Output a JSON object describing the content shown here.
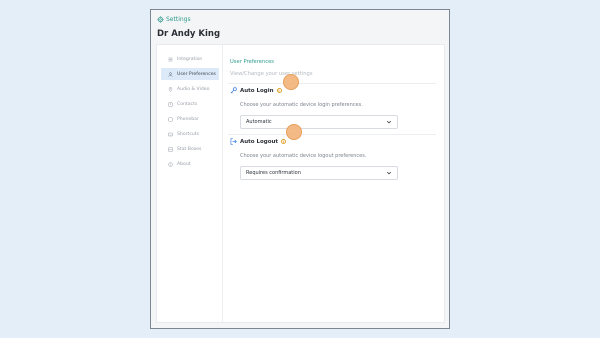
{
  "header": {
    "settings_label": "Settings",
    "user_name": "Dr Andy King"
  },
  "sidebar": {
    "items": [
      {
        "label": "Integration",
        "icon": "list-icon"
      },
      {
        "label": "User Preferences",
        "icon": "user-icon",
        "active": true
      },
      {
        "label": "Audio & Video",
        "icon": "location-pin-icon"
      },
      {
        "label": "Contacts",
        "icon": "address-book-icon"
      },
      {
        "label": "Phonebar",
        "icon": "phone-icon"
      },
      {
        "label": "Shortcuts",
        "icon": "keyboard-icon"
      },
      {
        "label": "Stat Boxes",
        "icon": "stat-box-icon"
      },
      {
        "label": "About",
        "icon": "info-icon"
      }
    ]
  },
  "main": {
    "title": "User Preferences",
    "subtitle": "View/Change your user settings",
    "auto_login": {
      "label": "Auto Login",
      "description": "Choose your automatic device login preferences.",
      "value": "Automatic"
    },
    "auto_logout": {
      "label": "Auto Logout",
      "description": "Choose your automatic device logout preferences.",
      "value": "Requires confirmation"
    }
  },
  "colors": {
    "accent": "#2f9a8c",
    "active_nav": "#dbe9f8",
    "marker": "#f3b77f",
    "info": "#e0a32f"
  }
}
